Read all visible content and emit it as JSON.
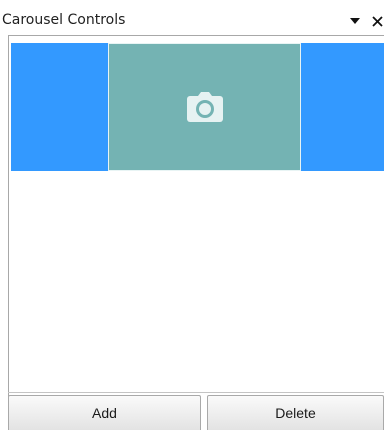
{
  "panel": {
    "title": "Carousel Controls",
    "dropdown_icon": "triangle-down-icon",
    "close_icon": "close-icon"
  },
  "carousel": {
    "background_color": "#3399ff",
    "slide_color": "#74b3b3",
    "slide_icon": "camera-icon"
  },
  "buttons": {
    "add_label": "Add",
    "delete_label": "Delete"
  }
}
